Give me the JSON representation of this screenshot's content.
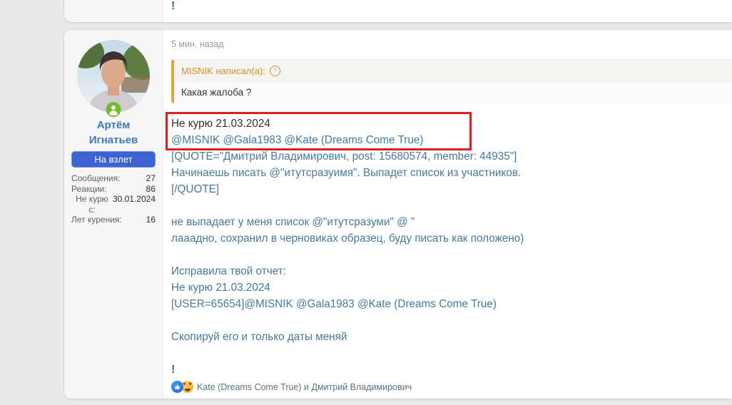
{
  "colors": {
    "page_background": "#e9e9e9",
    "card_background": "#ffffff",
    "user_panel_background": "#f6f6f6",
    "red_highlight_border": "#d92121",
    "quote_accent_orange": "#e9a13c",
    "link_blue": "#3d7bad",
    "username_blue": "#3e79bd",
    "banner_blue": "#3d63d2",
    "online_green": "#75b82e"
  },
  "icons": {
    "quote_arrow": "↑",
    "reaction_like": "thumbs-up",
    "reaction_love": "heart-eyes",
    "online_badge": "person"
  },
  "previous_post": {
    "text": "!"
  },
  "post": {
    "timestamp": "5 мин. назад",
    "user": {
      "name_line1": "Артём",
      "name_line2": "Игнатьев",
      "banner": "На взлет",
      "stats": [
        {
          "label": "Сообщения:",
          "value": "27"
        },
        {
          "label": "Реакции:",
          "value": "86"
        },
        {
          "label": "Не курю с:",
          "value": "30.01.2024"
        },
        {
          "label": "Лет курения:",
          "value": "16"
        }
      ]
    },
    "quote": {
      "attribution": "MISNIK написал(а):",
      "body": "Какая жалоба ?"
    },
    "body": {
      "highlight_line1": "Не курю 21.03.2024",
      "highlight_line2": "@MISNIK @Gala1983 @Kate (Dreams Come True)",
      "lines": [
        "[QUOTE=\"Дмитрий Владимирович, post: 15680574, member: 44935\"]",
        "Начинаешь писать @\"итутсразуимя\". Выпадет список из участников.",
        "[/QUOTE]",
        "",
        "не выпадает у меня список @\"итутсразуми\" @ \"",
        "лааадно, сохранил в черновиках образец, буду писать как положено)",
        "",
        "Исправила твой отчет:",
        "Не курю 21.03.2024",
        "[USER=65654]@MISNIK @Gala1983 @Kate (Dreams Come True)",
        "",
        "Скопируй его и только даты меняй",
        "",
        "!"
      ]
    },
    "reactions": {
      "text": "Kate (Dreams Come True) и Дмитрий Владимирович"
    }
  }
}
